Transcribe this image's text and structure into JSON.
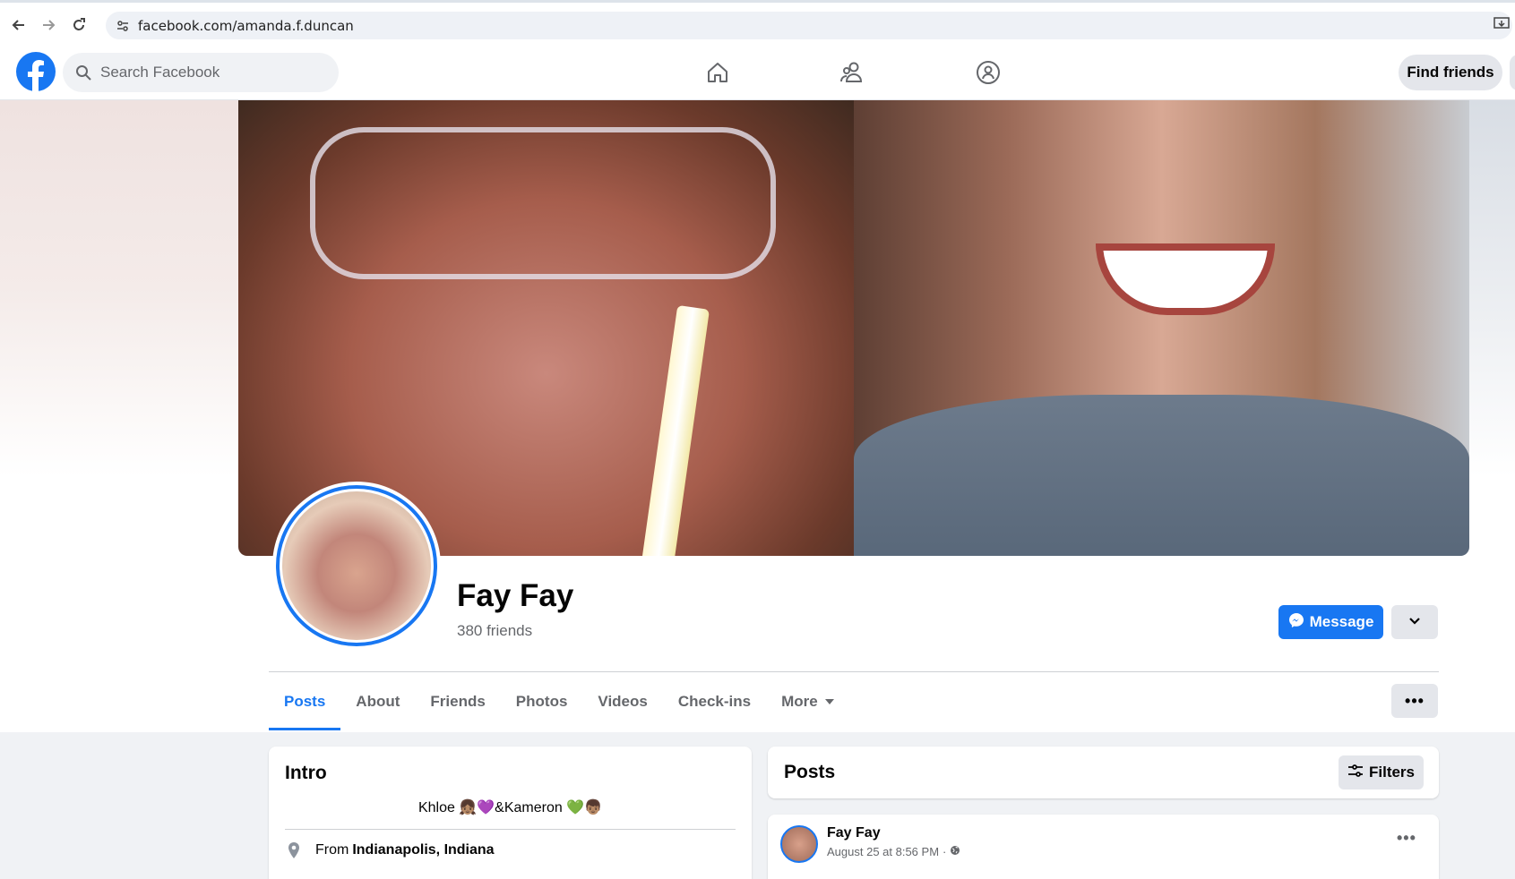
{
  "browser": {
    "url": "facebook.com/amanda.f.duncan"
  },
  "topbar": {
    "search_placeholder": "Search Facebook",
    "find_friends_label": "Find friends"
  },
  "profile": {
    "name": "Fay Fay",
    "friends": "380 friends",
    "message_label": "Message"
  },
  "tabs": [
    {
      "label": "Posts",
      "active": true
    },
    {
      "label": "About"
    },
    {
      "label": "Friends"
    },
    {
      "label": "Photos"
    },
    {
      "label": "Videos"
    },
    {
      "label": "Check-ins"
    },
    {
      "label": "More"
    }
  ],
  "intro": {
    "title": "Intro",
    "bio": "Khloe 👧🏽💜&Kameron 💚👦🏽",
    "from_prefix": "From",
    "from_place": "Indianapolis, Indiana"
  },
  "posts": {
    "title": "Posts",
    "filters_label": "Filters",
    "items": [
      {
        "author": "Fay Fay",
        "time": "August 25 at 8:56 PM",
        "separator": "·"
      }
    ]
  },
  "colors": {
    "brand": "#1877f2",
    "secondary_text": "#65676b",
    "button_gray": "#e4e6eb"
  }
}
